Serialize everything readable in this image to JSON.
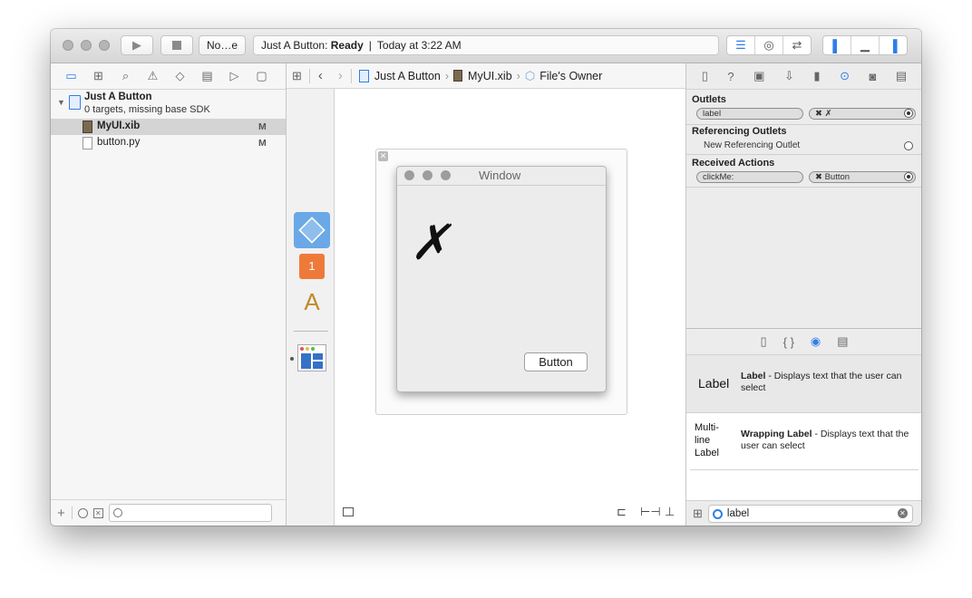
{
  "toolbar": {
    "scheme": "No…e",
    "status_project": "Just A Button",
    "status_state": "Ready",
    "status_separator": "|",
    "status_time": "Today at 3:22 AM"
  },
  "navigator": {
    "project_name": "Just A Button",
    "project_subtitle": "0 targets, missing base SDK",
    "files": [
      {
        "name": "MyUI.xib",
        "badge": "M"
      },
      {
        "name": "button.py",
        "badge": "M"
      }
    ]
  },
  "jumpbar": {
    "crumbs": [
      "Just A Button",
      "MyUI.xib",
      "File's Owner"
    ]
  },
  "canvas": {
    "window_title": "Window",
    "label_text": "✗",
    "button_label": "Button"
  },
  "inspector": {
    "outlets_title": "Outlets",
    "outlet": {
      "name": "label",
      "target": "✖ ✗"
    },
    "referencing_title": "Referencing Outlets",
    "referencing_new": "New Referencing Outlet",
    "actions_title": "Received Actions",
    "action": {
      "name": "clickMe:",
      "target": "✖ Button"
    }
  },
  "library": {
    "items": [
      {
        "icon_text": "Label",
        "title": "Label",
        "description": " - Displays text that the user can select"
      },
      {
        "icon_text": "Multi-\nline\nLabel",
        "title": "Wrapping Label",
        "description": " - Displays text that the user can select"
      }
    ],
    "filter_value": "label"
  },
  "colors": {
    "accent": "#2f7ee8",
    "selection": "#d4d4d4"
  }
}
